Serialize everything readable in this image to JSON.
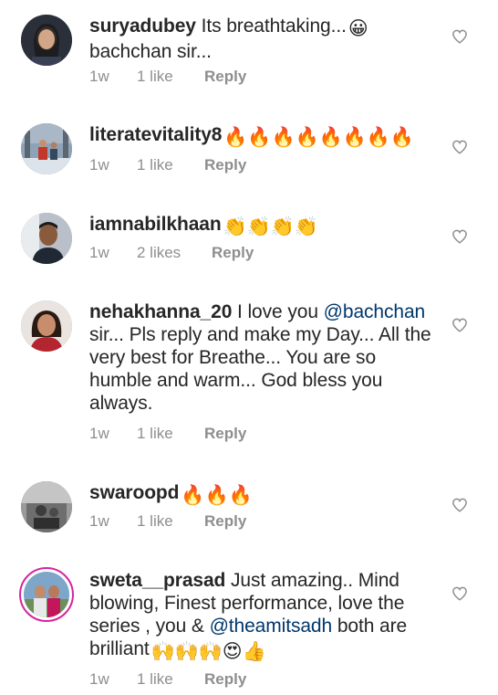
{
  "comments": [
    {
      "username": "suryadubey",
      "text": " Its breathtaking...",
      "text_after_emoji": "bachchan sir...",
      "emoji": "😀",
      "time": "1w",
      "likes": "1 like",
      "reply": "Reply"
    },
    {
      "username": "literatevitality8",
      "emoji": "🔥🔥🔥🔥🔥🔥🔥🔥",
      "time": "1w",
      "likes": "1 like",
      "reply": "Reply"
    },
    {
      "username": "iamnabilkhaan",
      "emoji": "👏👏👏👏",
      "time": "1w",
      "likes": "2 likes",
      "reply": "Reply"
    },
    {
      "username": "nehakhanna_20",
      "text_before_mention": " I love you ",
      "mention": "@bachchan",
      "text_after_mention": "sir... Pls reply and make my Day... All the very best for Breathe... You are so humble and warm... God bless you always.",
      "time": "1w",
      "likes": "1 like",
      "reply": "Reply"
    },
    {
      "username": "swaroopd",
      "emoji": "🔥🔥🔥",
      "time": "1w",
      "likes": "1 like",
      "reply": "Reply"
    },
    {
      "username": "sweta__prasad",
      "text_before_mention": " Just amazing.. Mind blowing, Finest performance, love the series , you & ",
      "mention": "@theamitsadh",
      "text_after_mention": " both are brilliant",
      "emoji": "🙌🙌🙌😍👍",
      "time": "1w",
      "likes": "1 like",
      "reply": "Reply"
    }
  ],
  "icons": {
    "like": "heart-outline-icon"
  },
  "colors": {
    "meta": "#8e8e8e",
    "mention": "#00376b",
    "story_ring": "#d6249f"
  }
}
